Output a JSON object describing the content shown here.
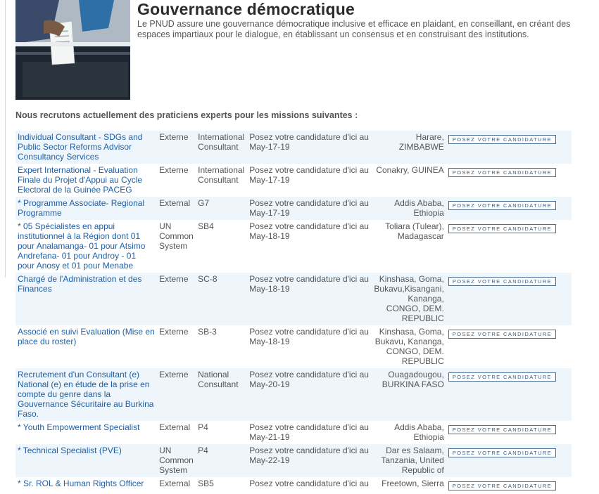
{
  "hero": {
    "title": "Gouvernance démocratique",
    "description": "Le PNUD assure une gouvernance démocratique inclusive et efficace en plaidant, en conseillant, en créant des espaces impartiaux pour le dialogue, en établissant un consensus et en construisant des institutions."
  },
  "intro": "Nous recrutons actuellement des praticiens experts pour les missions suivantes :",
  "deadline_label": "Posez votre candidature d'ici au",
  "apply_label": "POSEZ VOTRE CANDIDATURE",
  "jobs": [
    {
      "title": "Individual Consultant - SDGs and Public Sector Reforms Advisor Consultancy Services",
      "type": "Externe",
      "grade": "International Consultant",
      "deadline": "May-17-19",
      "location": "Harare, ZIMBABWE"
    },
    {
      "title": "Expert International - Evaluation Finale du Projet d'Appui au Cycle Electoral de la Guinée PACEG",
      "type": "Externe",
      "grade": "International Consultant",
      "deadline": "May-17-19",
      "location": "Conakry, GUINEA"
    },
    {
      "title": "* Programme Associate- Regional Programme",
      "type": "External",
      "grade": "G7",
      "deadline": "May-17-19",
      "location": "Addis Ababa, Ethiopia"
    },
    {
      "title": "* 05 Spécialistes en appui institutionnel à la Région dont 01 pour Analamanga- 01 pour Atsimo Andrefana- 01 pour Androy - 01 pour Anosy et 01 pour Menabe",
      "type": "UN Common System",
      "grade": "SB4",
      "deadline": "May-18-19",
      "location": "Toliara (Tulear), Madagascar"
    },
    {
      "title": "Chargé de l'Administration et des Finances",
      "type": "Externe",
      "grade": "SC-8",
      "deadline": "May-18-19",
      "location": "Kinshasa, Goma, Bukavu,Kisangani, Kananga, CONGO, DEM. REPUBLIC"
    },
    {
      "title": "Associé en suivi Evaluation (Mise en place du roster)",
      "type": "Externe",
      "grade": "SB-3",
      "deadline": "May-18-19",
      "location": "Kinshasa, Goma, Bukavu, Kananga, CONGO, DEM. REPUBLIC"
    },
    {
      "title": "Recrutement d'un Consultant (e) National (e) en étude de la prise en compte du genre dans la Gouvernance Sécuritaire au Burkina Faso.",
      "type": "Externe",
      "grade": "National Consultant",
      "deadline": "May-20-19",
      "location": "Ouagadougou, BURKINA FASO"
    },
    {
      "title": "* Youth Empowerment Specialist",
      "type": "External",
      "grade": "P4",
      "deadline": "May-21-19",
      "location": "Addis Ababa, Ethiopia"
    },
    {
      "title": "* Technical Specialist (PVE)",
      "type": "UN Common System",
      "grade": "P4",
      "deadline": "May-22-19",
      "location": "Dar es Salaam, Tanzania, United Republic of"
    },
    {
      "title": "* Sr. ROL & Human Rights Officer",
      "type": "External",
      "grade": "SB5",
      "deadline": "",
      "location": "Freetown, Sierra"
    }
  ]
}
